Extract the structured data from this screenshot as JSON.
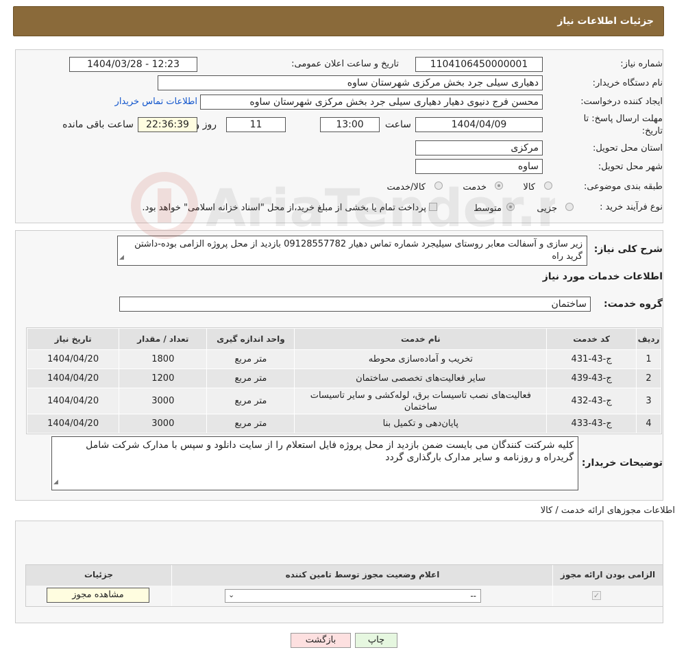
{
  "header": {
    "title": "جزئیات اطلاعات نیاز"
  },
  "form": {
    "need_no_label": "شماره نیاز:",
    "need_no": "1104106450000001",
    "announce_label": "تاریخ و ساعت اعلان عمومی:",
    "announce_value": "1404/03/28 - 12:23",
    "buyer_label": "نام دستگاه خریدار:",
    "buyer_value": "دهیاری سیلی جرد بخش مرکزی شهرستان ساوه",
    "creator_label": "ایجاد کننده درخواست:",
    "creator_value": "محسن فرج دنیوی دهیار دهیاری سیلی جرد بخش مرکزی شهرستان ساوه",
    "contact_link": "اطلاعات تماس خریدار",
    "deadline_label": "مهلت ارسال پاسخ: تا تاریخ:",
    "deadline_date": "1404/04/09",
    "time_label": "ساعت",
    "deadline_time": "13:00",
    "days_value": "11",
    "days_label": "روز و",
    "remaining_value": "22:36:39",
    "remaining_label": "ساعت باقی مانده",
    "province_label": "استان محل تحویل:",
    "province_value": "مرکزی",
    "city_label": "شهر محل تحویل:",
    "city_value": "ساوه",
    "category_label": "طبقه بندی موضوعی:",
    "category_options": [
      "کالا",
      "خدمت",
      "کالا/خدمت"
    ],
    "process_label": "نوع فرآیند خرید :",
    "process_options": [
      "جزیی",
      "متوسط"
    ],
    "process_note": "پرداخت تمام یا بخشی از مبلغ خرید،از محل \"اسناد خزانه اسلامی\" خواهد بود."
  },
  "summary": {
    "label": "شرح کلی نیاز:",
    "text": "زیر سازی و آسفالت معابر روستای سیلیجرد شماره تماس دهیار 09128557782 بازدید از محل پروژه الزامی بوده-داشتن گرید راه"
  },
  "services": {
    "section_title": "اطلاعات خدمات مورد نیاز",
    "group_label": "گروه خدمت:",
    "group_value": "ساختمان",
    "columns": [
      "ردیف",
      "کد خدمت",
      "نام خدمت",
      "واحد اندازه گیری",
      "تعداد / مقدار",
      "تاریخ نیاز"
    ],
    "rows": [
      {
        "idx": "1",
        "code": "ج-43-431",
        "name": "تخریب و آماده‌سازی محوطه",
        "unit": "متر مربع",
        "qty": "1800",
        "date": "1404/04/20"
      },
      {
        "idx": "2",
        "code": "ج-43-439",
        "name": "سایر فعالیت‌های تخصصی ساختمان",
        "unit": "متر مربع",
        "qty": "1200",
        "date": "1404/04/20"
      },
      {
        "idx": "3",
        "code": "ج-43-432",
        "name": "فعالیت‌های نصب تاسیسات برق، لوله‌کشی و سایر تاسیسات ساختمان",
        "unit": "متر مربع",
        "qty": "3000",
        "date": "1404/04/20"
      },
      {
        "idx": "4",
        "code": "ج-43-433",
        "name": "پایان‌دهی و تکمیل بنا",
        "unit": "متر مربع",
        "qty": "3000",
        "date": "1404/04/20"
      }
    ]
  },
  "buyer_notes": {
    "label": "توضیحات خریدار:",
    "text": "کلیه شرکتت کنندگان می بایست ضمن بازدید از محل پروژه فایل استعلام را از سایت دانلود و سپس با مدارک شرکت شامل گریدراه و روزنامه و سایر مدارک بارگذاری گردد"
  },
  "licenses": {
    "title": "اطلاعات مجوزهای ارائه خدمت / کالا",
    "col_required": "الزامی بودن ارائه مجوز",
    "col_status": "اعلام وضعیت مجوز توسط تامین کننده",
    "col_details": "جزئیات",
    "select_value": "--",
    "view_button": "مشاهده مجوز"
  },
  "footer": {
    "print": "چاپ",
    "back": "بازگشت"
  },
  "watermark": {
    "text": "AriaTender.neT"
  },
  "colors": {
    "header_bg": "#8a6a3a",
    "link": "#1155cc",
    "back_bg": "#fde0e0",
    "print_bg": "#e6f7e0"
  }
}
